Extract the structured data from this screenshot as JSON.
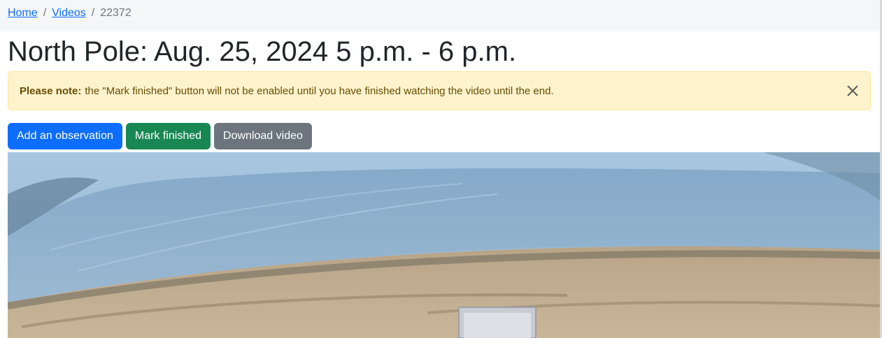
{
  "breadcrumb": {
    "home": "Home",
    "videos": "Videos",
    "separator": "/",
    "current": "22372"
  },
  "page": {
    "title": "North Pole: Aug. 25, 2024 5 p.m. - 6 p.m."
  },
  "alert": {
    "label": "Please note:",
    "message": "the \"Mark finished\" button will not be enabled until you have finished watching the video until the end.",
    "close_icon": "close-icon"
  },
  "actions": {
    "add_observation": "Add an observation",
    "mark_finished": "Mark finished",
    "download_video": "Download video"
  },
  "colors": {
    "primary": "#0d6efd",
    "success": "#198754",
    "secondary": "#6c757d",
    "alert_bg": "#fff3cd",
    "alert_text": "#664d03"
  }
}
